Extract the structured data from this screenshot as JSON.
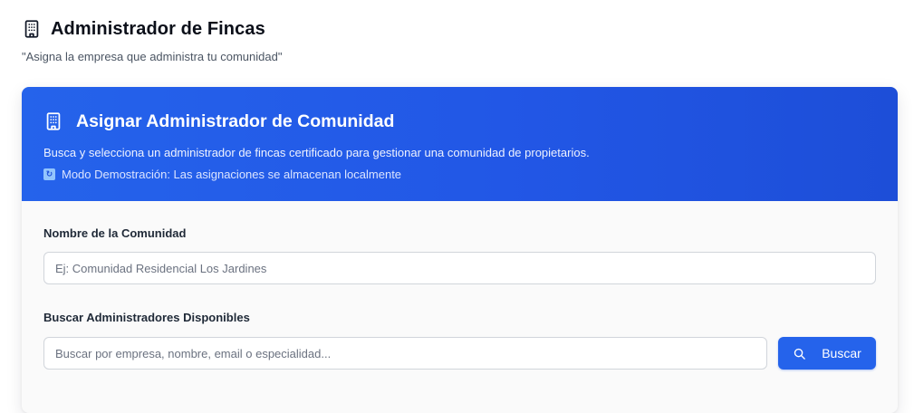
{
  "page": {
    "title": "Administrador de Fincas",
    "subtitle": "\"Asigna la empresa que administra tu comunidad\"",
    "title_icon": "building-icon"
  },
  "card": {
    "title": "Asignar Administrador de Comunidad",
    "title_icon": "building-icon",
    "description": "Busca y selecciona un administrador de fincas certificado para gestionar una comunidad de propietarios.",
    "demo_icon": "refresh-icon",
    "demo_notice": "Modo Demostración: Las asignaciones se almacenan localmente",
    "header_color": "#2563eb"
  },
  "form": {
    "community_label": "Nombre de la Comunidad",
    "community_placeholder": "Ej: Comunidad Residencial Los Jardines",
    "community_value": "",
    "search_label": "Buscar Administradores Disponibles",
    "search_placeholder": "Buscar por empresa, nombre, email o especialidad...",
    "search_value": "",
    "search_button": "Buscar",
    "search_button_icon": "search-icon",
    "accent_color": "#2563eb"
  }
}
